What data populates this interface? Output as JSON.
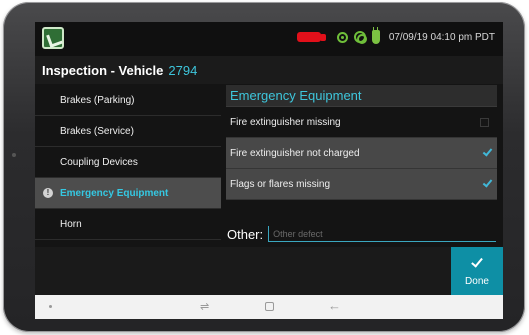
{
  "status_bar": {
    "datetime": "07/09/19 04:10 pm PDT",
    "icons": [
      "app-logo-icon",
      "truck-icon",
      "gps-icon",
      "wifi-icon",
      "plug-icon"
    ]
  },
  "title_bar": {
    "title": "Inspection - Vehicle",
    "vehicle_number": "2794"
  },
  "categories": [
    {
      "label": "Brakes (Parking)",
      "selected": false
    },
    {
      "label": "Brakes (Service)",
      "selected": false
    },
    {
      "label": "Coupling Devices",
      "selected": false
    },
    {
      "label": "Emergency Equipment",
      "selected": true,
      "has_warning": true
    },
    {
      "label": "Horn",
      "selected": false
    }
  ],
  "panel": {
    "header": "Emergency Equipment",
    "defects": [
      {
        "label": "Fire extinguisher missing",
        "checked": false
      },
      {
        "label": "Fire extinguisher not charged",
        "checked": true
      },
      {
        "label": "Flags or flares missing",
        "checked": true
      }
    ]
  },
  "other": {
    "label": "Other:",
    "value": "",
    "placeholder": "Other defect"
  },
  "done_button": {
    "label": "Done"
  },
  "colors": {
    "accent": "#3ec6dc",
    "done_bg": "#0e8fa5",
    "selected_row": "#4d4d4d",
    "truck_status": "#e2101a",
    "gps_status": "#6fbf3a"
  },
  "nav_bar": {
    "icons": [
      "menu-dot-icon",
      "recent-apps-icon",
      "home-icon",
      "back-icon"
    ]
  }
}
